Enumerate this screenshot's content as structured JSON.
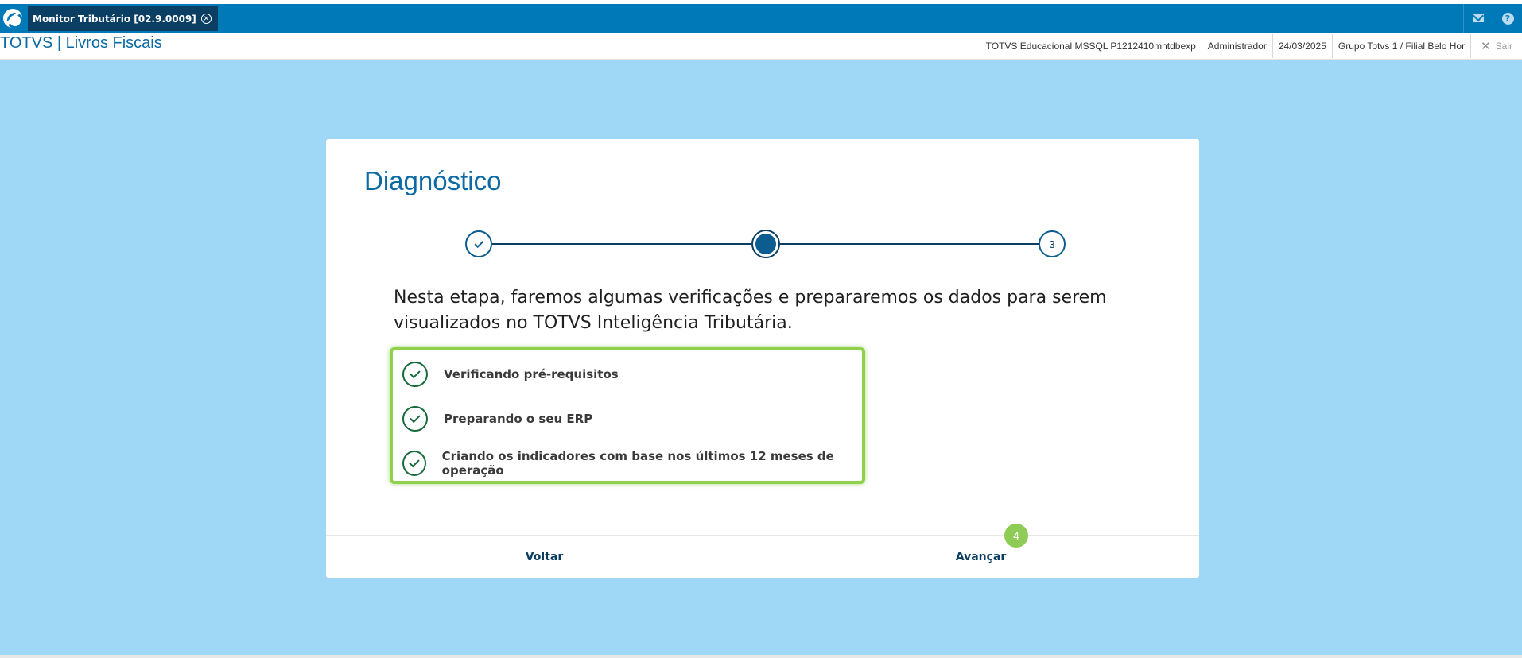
{
  "window": {
    "tab_title": "Monitor Tributário [02.9.0009]",
    "tab_close_icon": "close-circle-icon",
    "mail_icon": "mail-icon",
    "help_icon": "help-icon",
    "help_glyph": "?"
  },
  "header": {
    "brand": "TOTVS | Livros Fiscais",
    "environment": "TOTVS Educacional MSSQL P1212410mntdbexp",
    "user": "Administrador",
    "date": "24/03/2025",
    "branch": "Grupo Totvs 1 / Filial Belo Hor",
    "exit_label": "Sair",
    "exit_glyph": "✕"
  },
  "wizard": {
    "title": "Diagnóstico",
    "steps": [
      {
        "state": "done",
        "label": ""
      },
      {
        "state": "current",
        "label": ""
      },
      {
        "state": "pending",
        "label": "3"
      }
    ],
    "description": "Nesta etapa, faremos algumas verificações e prepararemos os dados para serem visualizados no TOTVS Inteligência Tributária.",
    "checklist": [
      {
        "label": "Verificando pré-requisitos",
        "status": "done"
      },
      {
        "label": "Preparando o seu ERP",
        "status": "done"
      },
      {
        "label": "Criando os indicadores com base nos últimos 12 meses de operação",
        "status": "done"
      }
    ],
    "back_label": "Voltar",
    "next_label": "Avançar",
    "annotation_badge": "4"
  },
  "colors": {
    "topbar": "#0079b9",
    "background": "#9fd7f7",
    "primary_dark": "#0a3f63",
    "highlight": "#8fd14a",
    "check_green": "#176a3c"
  }
}
